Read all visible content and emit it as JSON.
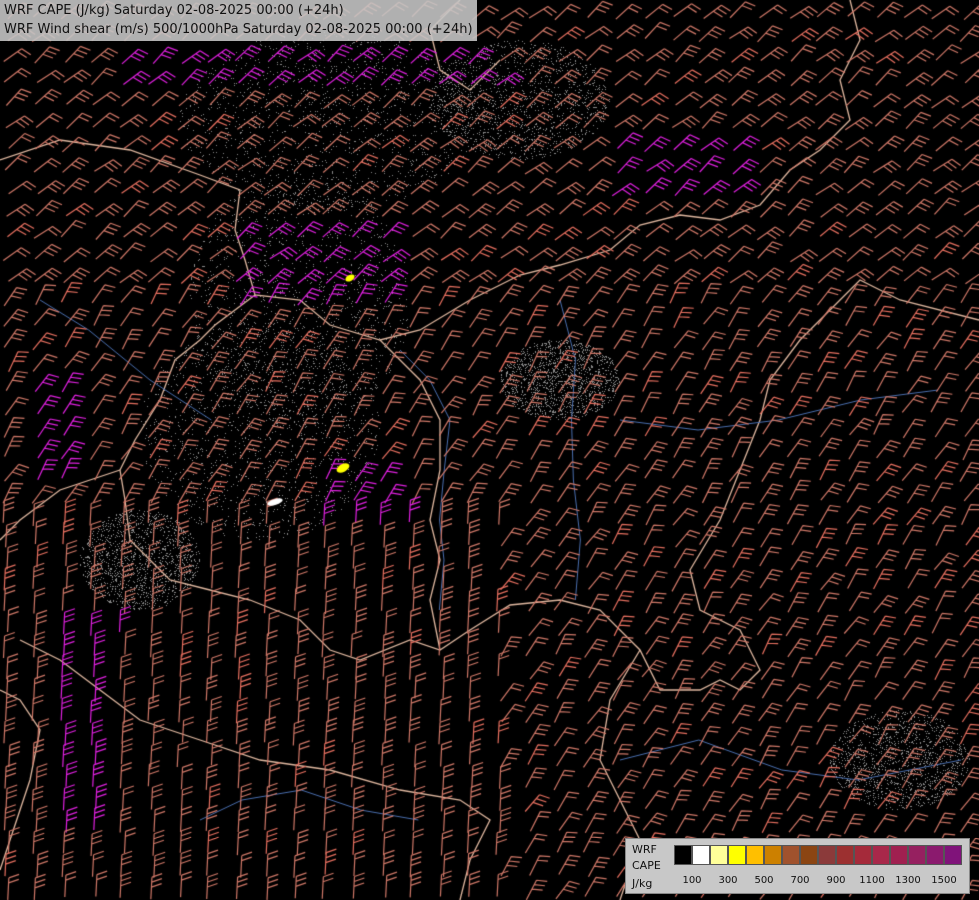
{
  "titles": {
    "line1": "WRF CAPE (J/kg) Saturday 02-08-2025 00:00 (+24h)",
    "line2": "WRF Wind shear (m/s) 500/1000hPa Saturday 02-08-2025 00:00 (+24h)"
  },
  "legend": {
    "model": "WRF",
    "variable": "CAPE",
    "unit": "J/kg",
    "colors": [
      "#000000",
      "#ffffff",
      "#ffff99",
      "#ffff00",
      "#ffbf00",
      "#cc8000",
      "#a0522d",
      "#8b4513",
      "#8b3a3a",
      "#9c3030",
      "#a52a3a",
      "#a8284a",
      "#a02050",
      "#962060",
      "#8b1a6e",
      "#80137a"
    ],
    "tick_labels": [
      "100",
      "300",
      "500",
      "700",
      "900",
      "1100",
      "1300",
      "1500"
    ]
  },
  "map_colors": {
    "background": "#000000",
    "border": "#e0b8a0",
    "river": "#4a6fb0",
    "barb_low": "#d07868",
    "barb_mid": "#e87060",
    "barb_high": "#e020e0",
    "stipple": "#8a8a8a"
  }
}
